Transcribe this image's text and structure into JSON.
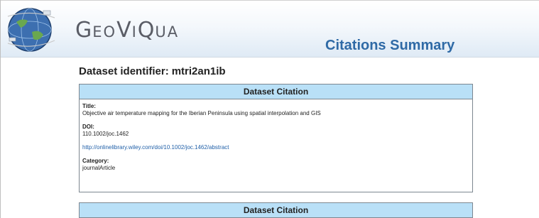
{
  "header": {
    "brand": {
      "g": "G",
      "eo": "EO",
      "v": "V",
      "i": "I",
      "q": "Q",
      "ua": "UA"
    },
    "title": "Citations Summary"
  },
  "dataset": {
    "label": "Dataset identifier:",
    "value": "mtri2an1ib"
  },
  "citations": [
    {
      "heading": "Dataset Citation",
      "title_label": "Title:",
      "title_value": "Objective air temperature mapping for the Iberian Peninsula using spatial interpolation and GIS",
      "doi_label": "DOI:",
      "doi_value": "110.1002/joc.1462",
      "link": "http://onlinelibrary.wiley.com/doi/10.1002/joc.1462/abstract",
      "category_label": "Category:",
      "category_value": "journalArticle"
    },
    {
      "heading": "Dataset Citation"
    }
  ],
  "colors": {
    "header_title": "#2f6aa6",
    "citation_head_bg": "#b9e0f7",
    "link": "#1f5fa8"
  }
}
